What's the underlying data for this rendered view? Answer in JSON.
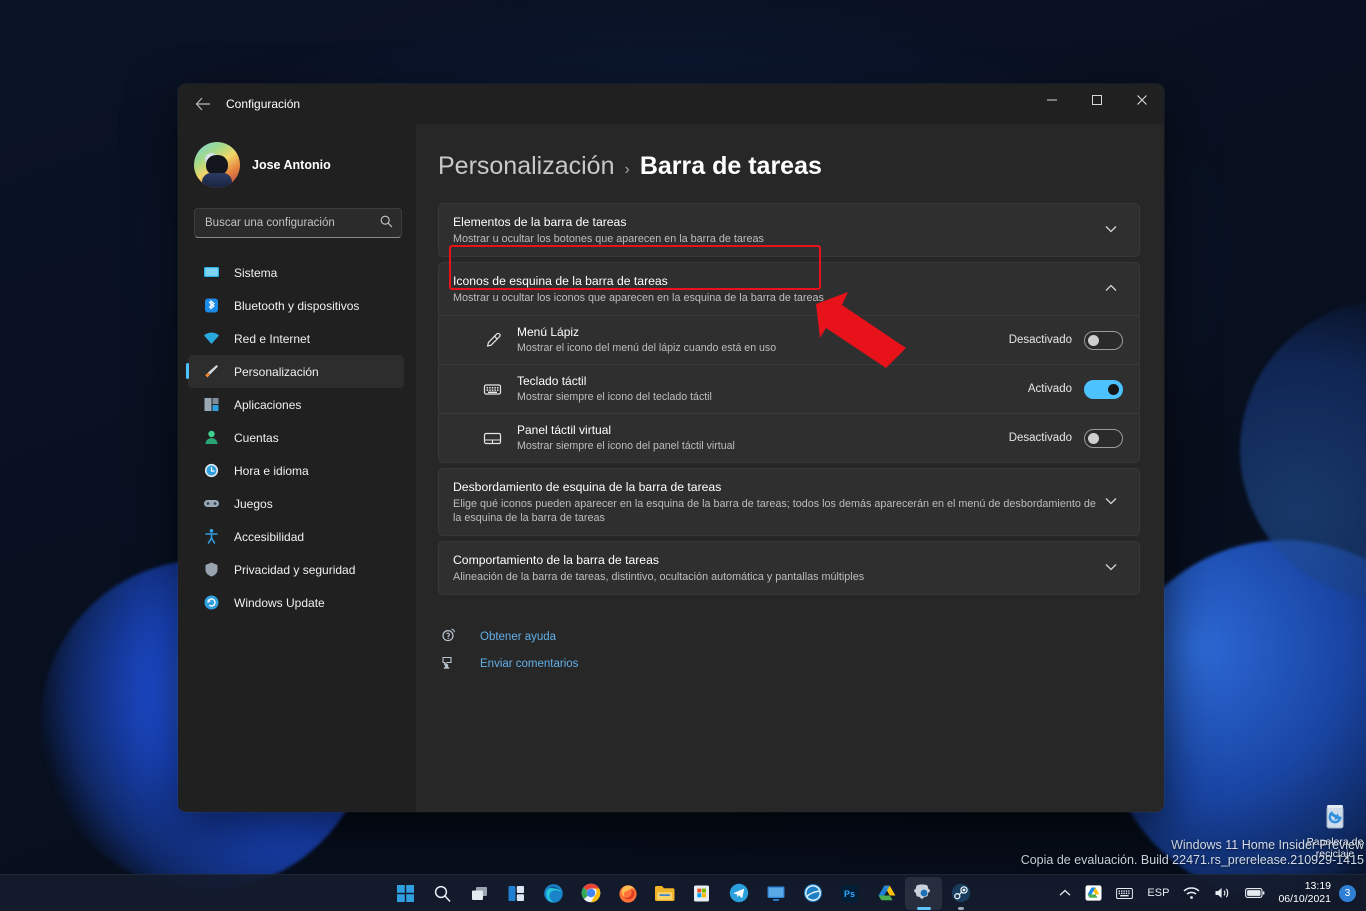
{
  "window": {
    "app_title": "Configuración",
    "back_icon": "back-arrow-icon",
    "controls": {
      "minimize": "minimize-icon",
      "maximize": "maximize-icon",
      "close": "close-icon"
    }
  },
  "sidebar": {
    "account_name": "Jose Antonio",
    "search": {
      "placeholder": "Buscar una configuración",
      "value": "",
      "icon": "search-icon"
    },
    "items": [
      {
        "label": "Sistema",
        "icon": "monitor-icon",
        "active": false
      },
      {
        "label": "Bluetooth y dispositivos",
        "icon": "bluetooth-icon",
        "active": false
      },
      {
        "label": "Red e Internet",
        "icon": "wifi-icon",
        "active": false
      },
      {
        "label": "Personalización",
        "icon": "paintbrush-icon",
        "active": true
      },
      {
        "label": "Aplicaciones",
        "icon": "apps-icon",
        "active": false
      },
      {
        "label": "Cuentas",
        "icon": "person-icon",
        "active": false
      },
      {
        "label": "Hora e idioma",
        "icon": "clock-icon",
        "active": false
      },
      {
        "label": "Juegos",
        "icon": "gamepad-icon",
        "active": false
      },
      {
        "label": "Accesibilidad",
        "icon": "accessibility-icon",
        "active": false
      },
      {
        "label": "Privacidad y seguridad",
        "icon": "shield-icon",
        "active": false
      },
      {
        "label": "Windows Update",
        "icon": "update-icon",
        "active": false
      }
    ]
  },
  "breadcrumb": {
    "parent": "Personalización",
    "separator": "›",
    "current": "Barra de tareas"
  },
  "cards": [
    {
      "title": "Elementos de la barra de tareas",
      "subtitle": "Mostrar u ocultar los botones que aparecen en la barra de tareas",
      "expanded": false,
      "chevron": "chevron-down-icon"
    },
    {
      "title": "Iconos de esquina de la barra de tareas",
      "subtitle": "Mostrar u ocultar los iconos que aparecen en la esquina de la barra de tareas",
      "expanded": true,
      "chevron": "chevron-up-icon",
      "highlighted": true
    },
    {
      "title": "Desbordamiento de esquina de la barra de tareas",
      "subtitle": "Elige qué iconos pueden aparecer en la esquina de la barra de tareas; todos los demás aparecerán en el menú de desbordamiento de la esquina de la barra de tareas",
      "expanded": false,
      "chevron": "chevron-down-icon"
    },
    {
      "title": "Comportamiento de la barra de tareas",
      "subtitle": "Alineación de la barra de tareas, distintivo, ocultación automática y pantallas múltiples",
      "expanded": false,
      "chevron": "chevron-down-icon"
    }
  ],
  "settings_rows": [
    {
      "title": "Menú Lápiz",
      "subtitle": "Mostrar el icono del menú del lápiz cuando está en uso",
      "state_label": "Desactivado",
      "state_on": false,
      "icon": "pen-icon"
    },
    {
      "title": "Teclado táctil",
      "subtitle": "Mostrar siempre el icono del teclado táctil",
      "state_label": "Activado",
      "state_on": true,
      "icon": "keyboard-icon"
    },
    {
      "title": "Panel táctil virtual",
      "subtitle": "Mostrar siempre el icono del panel táctil virtual",
      "state_label": "Desactivado",
      "state_on": false,
      "icon": "touchpad-icon"
    }
  ],
  "help_links": [
    {
      "label": "Obtener ayuda",
      "icon": "help-question-icon"
    },
    {
      "label": "Enviar comentarios",
      "icon": "feedback-icon"
    }
  ],
  "desktop": {
    "recycle_bin_label": "Papelera de reciclaje",
    "recycle_bin_icon": "recycle-bin-icon",
    "watermark_line1": "Windows 11 Home Insider Preview",
    "watermark_line2": "Copia de evaluación. Build 22471.rs_prerelease.210929-1415"
  },
  "taskbar": {
    "items": [
      {
        "name": "start-icon",
        "label": "Inicio"
      },
      {
        "name": "search-icon",
        "label": "Buscar"
      },
      {
        "name": "task-view-icon",
        "label": "Vista de tareas"
      },
      {
        "name": "widgets-icon",
        "label": "Widgets"
      },
      {
        "name": "edge-icon",
        "label": "Microsoft Edge"
      },
      {
        "name": "chrome-icon",
        "label": "Google Chrome"
      },
      {
        "name": "firefox-icon",
        "label": "Firefox"
      },
      {
        "name": "file-explorer-icon",
        "label": "Explorador de archivos"
      },
      {
        "name": "microsoft-store-icon",
        "label": "Microsoft Store"
      },
      {
        "name": "telegram-icon",
        "label": "Telegram"
      },
      {
        "name": "display-app-icon",
        "label": "Monitor"
      },
      {
        "name": "browser-globe-icon",
        "label": "Navegador"
      },
      {
        "name": "photoshop-icon",
        "label": "Ps"
      },
      {
        "name": "google-drive-icon",
        "label": "Google Drive"
      },
      {
        "name": "settings-icon",
        "label": "Configuración"
      },
      {
        "name": "steam-icon",
        "label": "Steam"
      }
    ],
    "tray": {
      "overflow_icon": "chevron-up-icon",
      "drive_icon": "google-drive-tray-icon",
      "keyboard_icon": "touch-keyboard-icon",
      "language": "ESP",
      "wifi_icon": "wifi-icon",
      "volume_icon": "volume-icon",
      "battery_icon": "battery-icon",
      "time": "13:19",
      "date": "06/10/2021",
      "notification_count": "3"
    }
  },
  "colors": {
    "accent": "#4cc2ff",
    "annotation_red": "#e8121b",
    "link_blue": "#63b0e8"
  }
}
